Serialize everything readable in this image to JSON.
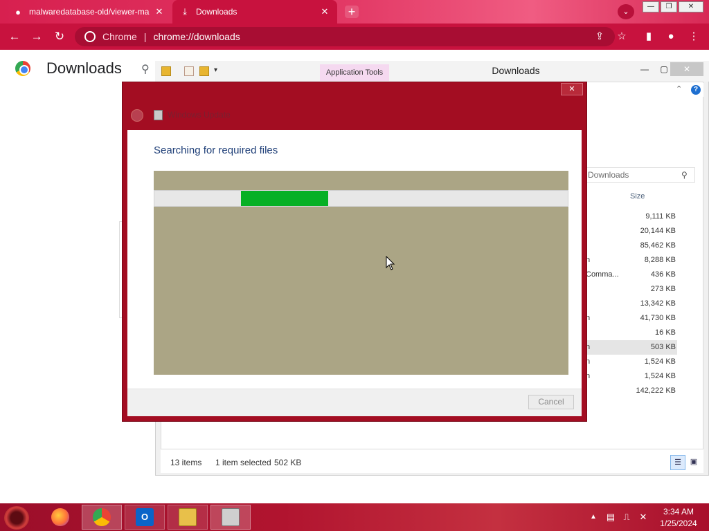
{
  "browser": {
    "tabs": [
      {
        "title": "malwaredatabase-old/viewer-ma",
        "icon": "github-icon"
      },
      {
        "title": "Downloads",
        "icon": "download-icon"
      }
    ],
    "new_tab_label": "+",
    "omnibox": {
      "site_label": "Chrome",
      "url": "chrome://downloads"
    }
  },
  "downloads_page": {
    "title": "Downloads"
  },
  "explorer": {
    "ribbon_tab": "Application Tools",
    "window_title": "Downloads",
    "search_placeholder": "Downloads",
    "column_header_size": "Size",
    "name_fragments": [
      "n",
      "Comma...",
      "n",
      "n",
      "n",
      "n"
    ],
    "sizes": [
      "9,111 KB",
      "20,144 KB",
      "85,462 KB",
      "8,288 KB",
      "436 KB",
      "273 KB",
      "13,342 KB",
      "41,730 KB",
      "16 KB",
      "503 KB",
      "1,524 KB",
      "1,524 KB",
      "142,222 KB"
    ],
    "status": {
      "items": "13 items",
      "selected": "1 item selected",
      "selected_size": "502 KB"
    }
  },
  "installer": {
    "app_title": "Windows Update",
    "heading": "Searching for required files",
    "progress": 0.21,
    "progress_offset": 0.21,
    "cancel_label": "Cancel",
    "close_label": "✕"
  },
  "taskbar": {
    "apps": [
      "firefox",
      "chrome",
      "outlook",
      "file-explorer",
      "installer"
    ],
    "clock_time": "3:34 AM",
    "clock_date": "1/25/2024"
  },
  "colors": {
    "chrome_theme": "#c8123e",
    "dialog_frame": "#a30d22",
    "progress_fill": "#06b025",
    "panel_fill": "#aba585"
  }
}
